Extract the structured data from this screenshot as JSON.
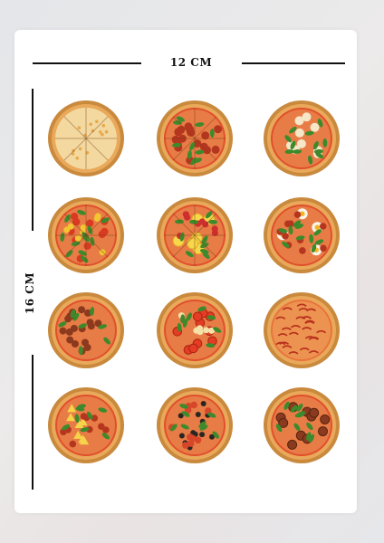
{
  "dimensions": {
    "width_label": "12 CM",
    "height_label": "16 CM"
  },
  "colors": {
    "crust": "#c98a3e",
    "cheese": "#f3d9a0",
    "sauce": "#e0502c",
    "pepperoni": "#b5361f",
    "basil": "#3d8a2c",
    "ruler": "#111111"
  },
  "stickers": [
    {
      "name": "cheese-pizza-sticker",
      "style": "cheese"
    },
    {
      "name": "pepperoni-pizza-sticker",
      "style": "pepperoni"
    },
    {
      "name": "margherita-pizza-sticker",
      "style": "margherita"
    },
    {
      "name": "veggie-pizza-sticker",
      "style": "veggie"
    },
    {
      "name": "lemon-pizza-sticker",
      "style": "lemon"
    },
    {
      "name": "egg-pizza-sticker",
      "style": "egg"
    },
    {
      "name": "meat-pizza-sticker",
      "style": "meat"
    },
    {
      "name": "tomato-pizza-sticker",
      "style": "tomato"
    },
    {
      "name": "spicy-pizza-sticker",
      "style": "spicy"
    },
    {
      "name": "pineapple-pizza-sticker",
      "style": "pineapple"
    },
    {
      "name": "olive-pizza-sticker",
      "style": "olive"
    },
    {
      "name": "meatball-pizza-sticker",
      "style": "meatball"
    }
  ]
}
